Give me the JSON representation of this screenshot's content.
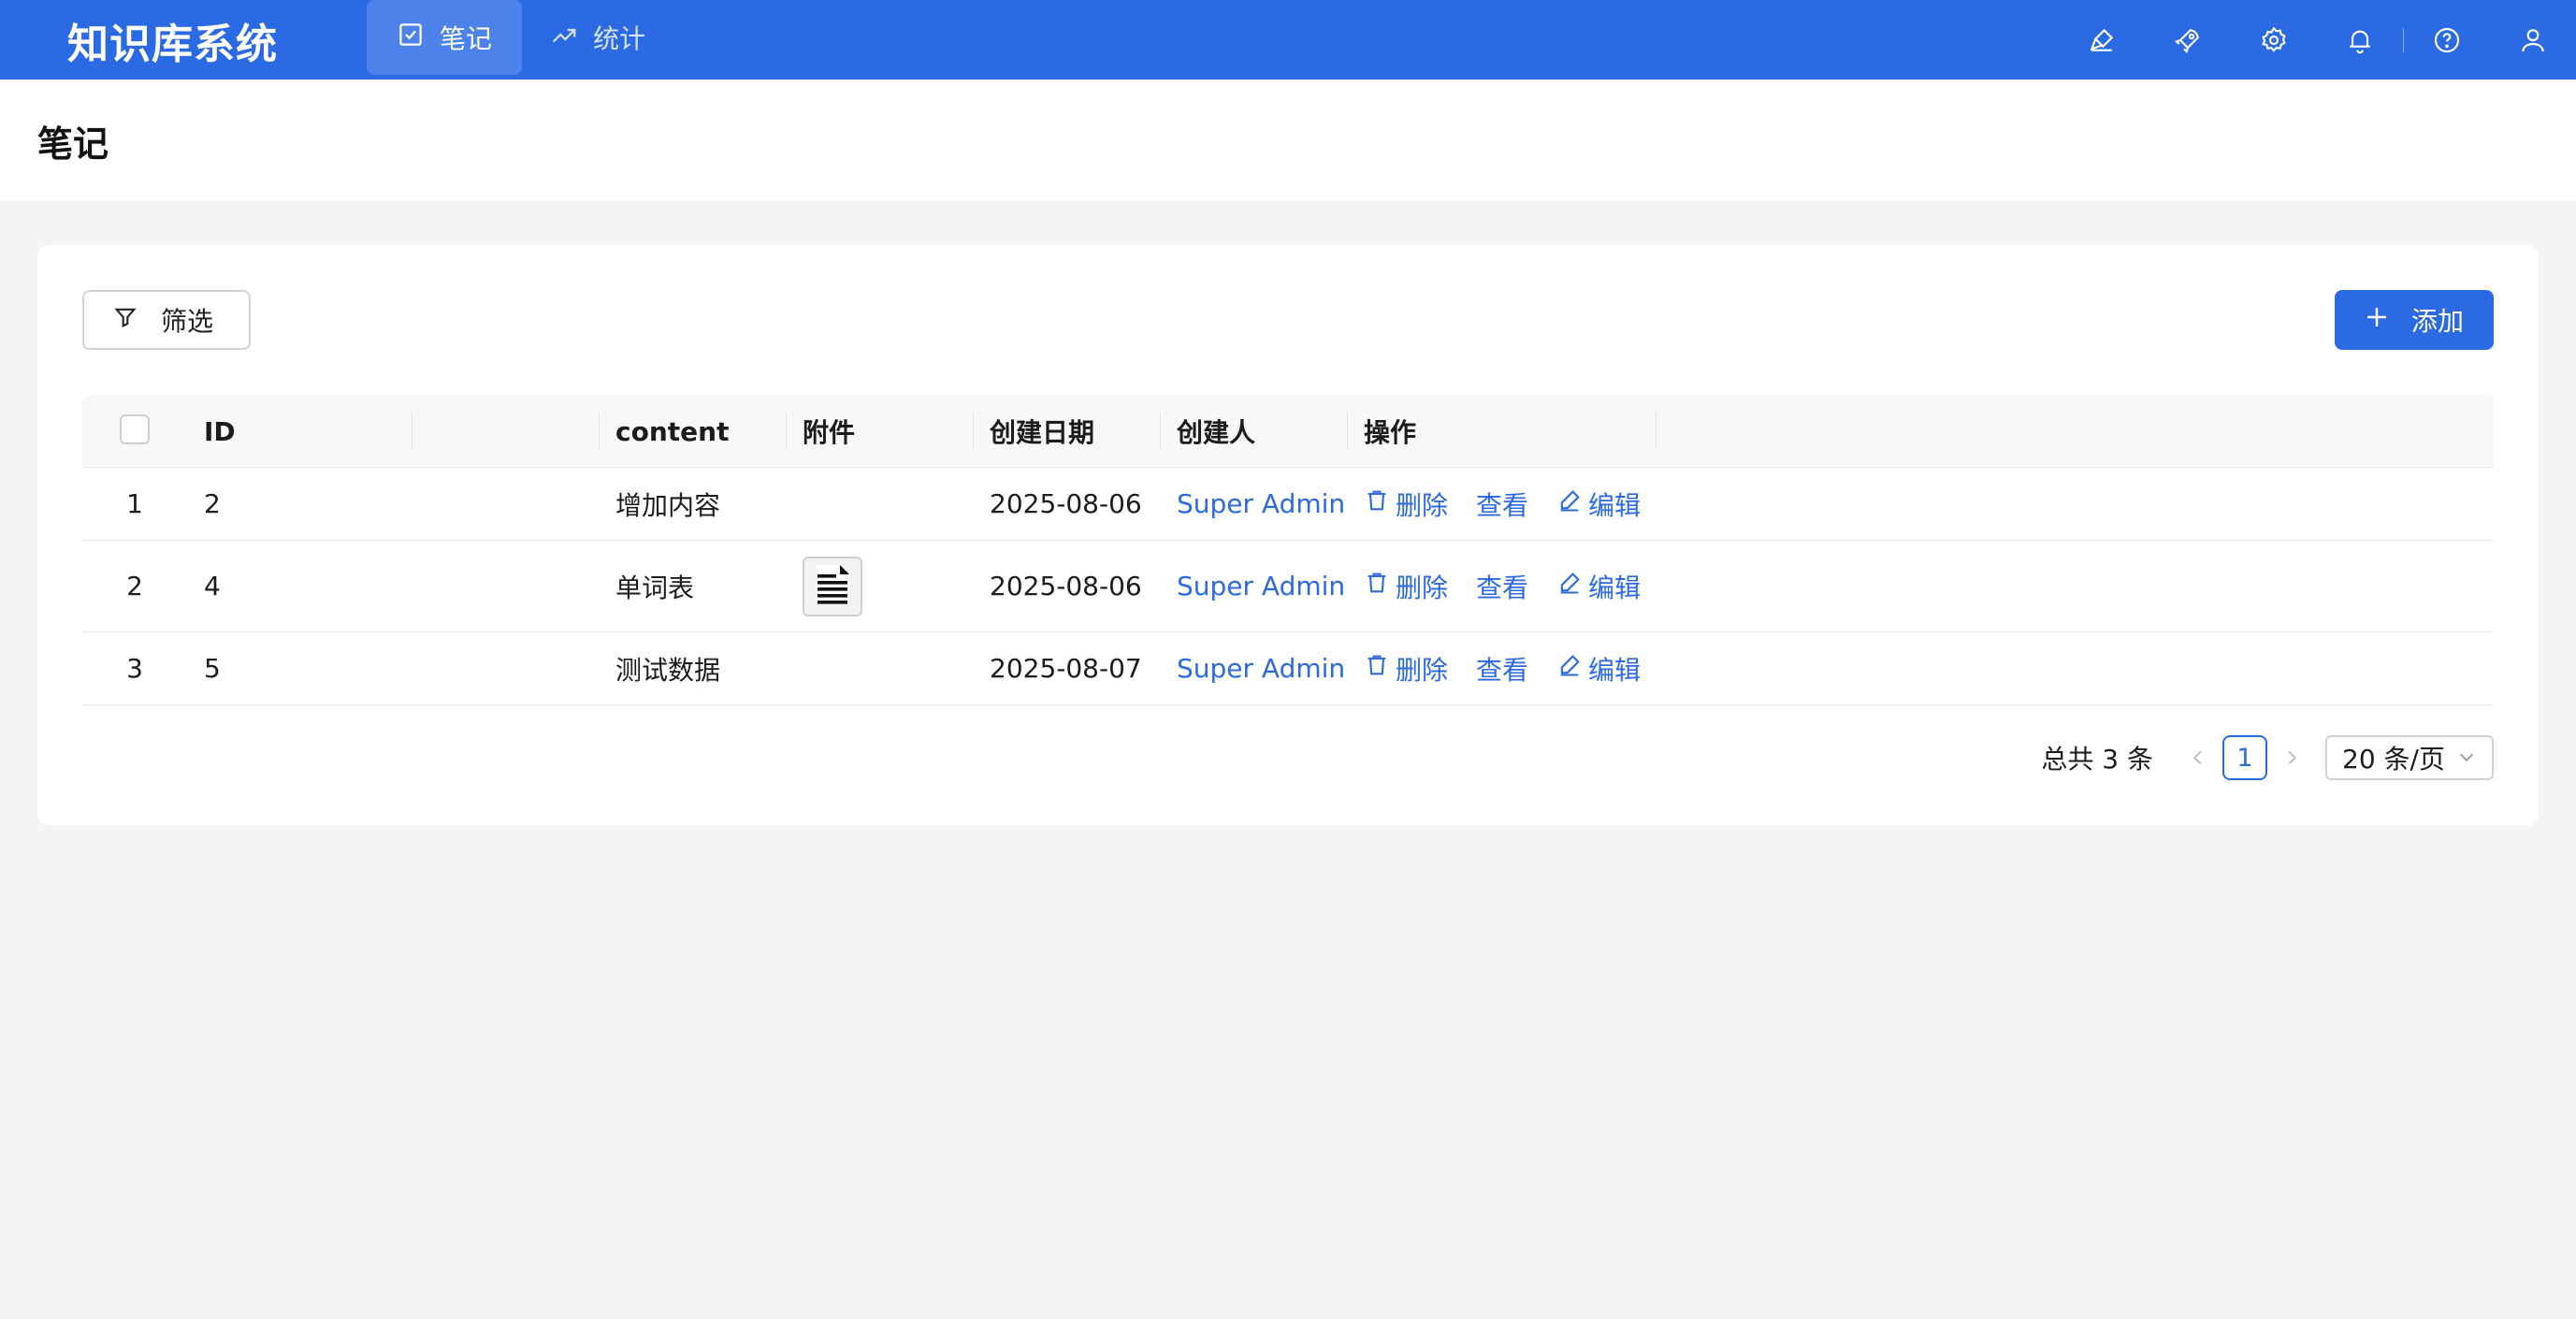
{
  "app": {
    "title": "知识库系统",
    "accent_color": "#2c6ae4"
  },
  "nav": {
    "tabs": [
      {
        "label": "笔记",
        "icon": "checkbox-icon",
        "active": true
      },
      {
        "label": "统计",
        "icon": "trend-line-icon",
        "active": false
      }
    ],
    "right_icons": [
      "brush-icon",
      "rocket-icon",
      "gear-icon",
      "bell-icon",
      "help-icon",
      "user-icon"
    ]
  },
  "page": {
    "title": "笔记"
  },
  "toolbar": {
    "filter_label": "筛选",
    "add_label": "添加"
  },
  "table": {
    "columns": {
      "id": "ID",
      "blank": "",
      "content": "content",
      "attachment": "附件",
      "created_date": "创建日期",
      "creator": "创建人",
      "actions": "操作"
    },
    "rows": [
      {
        "index": "1",
        "id": "2",
        "content": "增加内容",
        "has_attachment": false,
        "created_date": "2025-08-06",
        "creator": "Super Admin"
      },
      {
        "index": "2",
        "id": "4",
        "content": "单词表",
        "has_attachment": true,
        "created_date": "2025-08-06",
        "creator": "Super Admin"
      },
      {
        "index": "3",
        "id": "5",
        "content": "测试数据",
        "has_attachment": false,
        "created_date": "2025-08-07",
        "creator": "Super Admin"
      }
    ],
    "actions": {
      "delete": "删除",
      "view": "查看",
      "edit": "编辑"
    }
  },
  "pagination": {
    "total_text": "总共 3 条",
    "current_page": "1",
    "page_size": "20 条/页"
  }
}
